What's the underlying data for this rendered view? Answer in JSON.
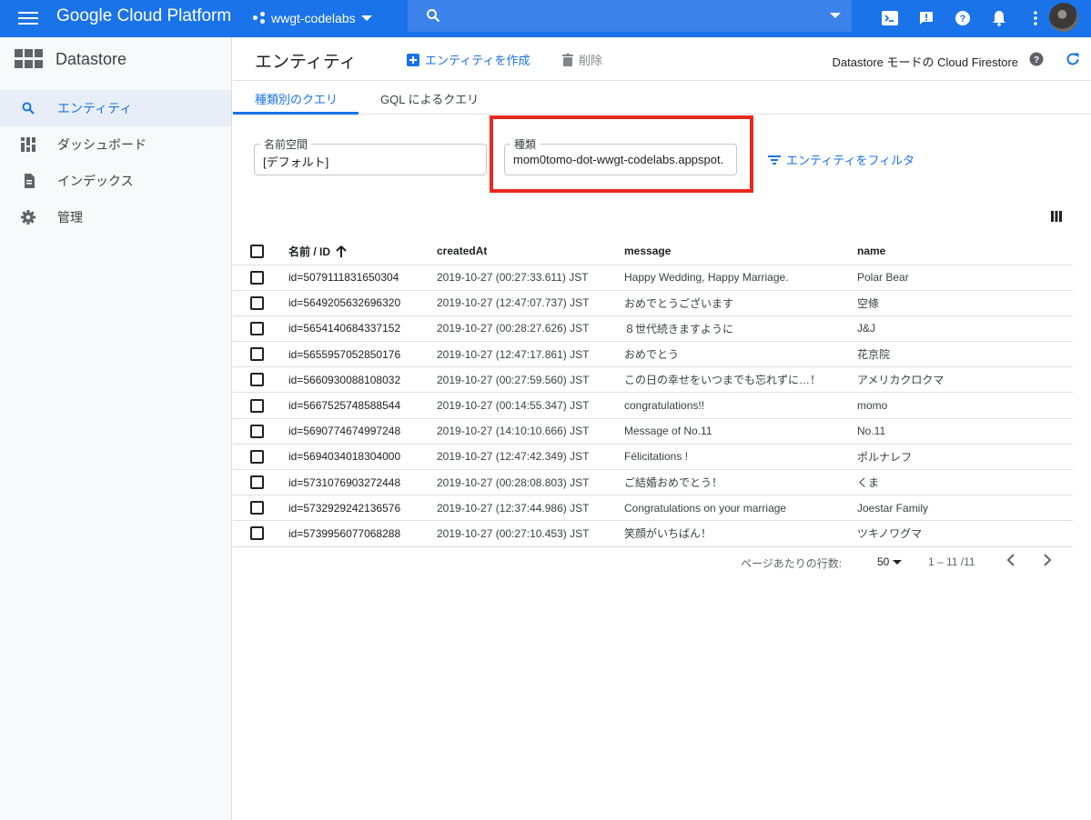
{
  "topbar": {
    "title": "Google Cloud Platform",
    "project": "wwgt-codelabs",
    "icons": [
      "cloud-shell-icon",
      "feedback-icon",
      "help-icon",
      "notifications-icon",
      "more-vert-icon"
    ]
  },
  "sidebar": {
    "product": "Datastore",
    "items": [
      {
        "label": "エンティティ",
        "icon": "search-icon",
        "active": true
      },
      {
        "label": "ダッシュボード",
        "icon": "dashboard-icon",
        "active": false
      },
      {
        "label": "インデックス",
        "icon": "index-icon",
        "active": false
      },
      {
        "label": "管理",
        "icon": "settings-icon",
        "active": false
      }
    ]
  },
  "toolbar": {
    "title": "エンティティ",
    "create_label": "エンティティを作成",
    "delete_label": "削除",
    "mode": "Datastore モードの Cloud Firestore"
  },
  "tabs": [
    {
      "label": "種類別のクエリ",
      "active": true
    },
    {
      "label": "GQL によるクエリ",
      "active": false
    }
  ],
  "query": {
    "namespace_label": "名前空間",
    "namespace_value": "[デフォルト]",
    "kind_label": "種類",
    "kind_value": "mom0tomo-dot-wwgt-codelabs.appspot.",
    "filter_label": "エンティティをフィルタ"
  },
  "table": {
    "headers": [
      "名前 / ID",
      "createdAt",
      "message",
      "name"
    ],
    "rows": [
      [
        "id=5079111831650304",
        "2019-10-27 (00:27:33.611) JST",
        "Happy Wedding, Happy Marriage.",
        "Polar Bear"
      ],
      [
        "id=5649205632696320",
        "2019-10-27 (12:47:07.737) JST",
        "おめでとうございます",
        "空條"
      ],
      [
        "id=5654140684337152",
        "2019-10-27 (00:28:27.626) JST",
        "８世代続きますように",
        "J&J"
      ],
      [
        "id=5655957052850176",
        "2019-10-27 (12:47:17.861) JST",
        "おめでとう",
        "花京院"
      ],
      [
        "id=5660930088108032",
        "2019-10-27 (00:27:59.560) JST",
        "この日の幸せをいつまでも忘れずに…！",
        "アメリカクロクマ"
      ],
      [
        "id=5667525748588544",
        "2019-10-27 (00:14:55.347) JST",
        "congratulations!!",
        "momo"
      ],
      [
        "id=5690774674997248",
        "2019-10-27 (14:10:10.666) JST",
        "Message of No.11",
        "No.11"
      ],
      [
        "id=5694034018304000",
        "2019-10-27 (12:47:42.349) JST",
        "Félicitations !",
        "ポルナレフ"
      ],
      [
        "id=5731076903272448",
        "2019-10-27 (00:28:08.803) JST",
        "ご結婚おめでとう！",
        "くま"
      ],
      [
        "id=5732929242136576",
        "2019-10-27 (12:37:44.986) JST",
        "Congratulations on your marriage",
        "Joestar Family"
      ],
      [
        "id=5739956077068288",
        "2019-10-27 (00:27:10.453) JST",
        "笑顔がいちばん！",
        "ツキノワグマ"
      ]
    ]
  },
  "pager": {
    "rows_label": "ページあたりの行数:",
    "rows_value": "50",
    "range": "1 – 11 /11"
  },
  "colors": {
    "brand": "#1a73e8",
    "highlight": "#e8281c"
  }
}
